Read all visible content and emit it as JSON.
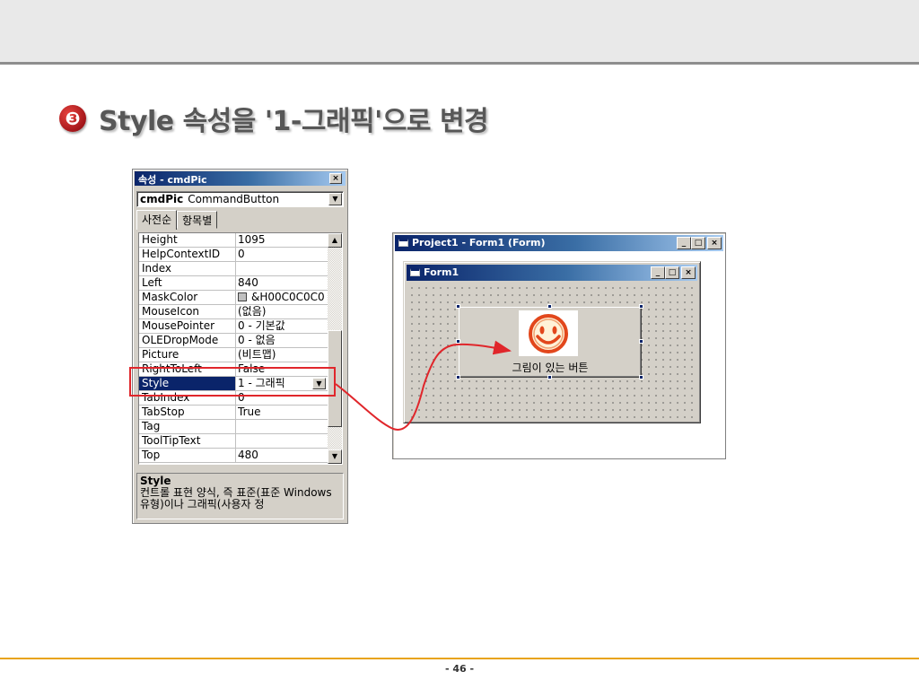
{
  "slide": {
    "step_number": "❸",
    "title": "Style 속성을 '1-그래픽'으로 변경",
    "page_number": "- 46 -"
  },
  "properties_window": {
    "title": "속성 - cmdPic",
    "close_glyph": "×",
    "object_name": "cmdPic",
    "object_type": "CommandButton",
    "tabs": [
      "사전순",
      "항목별"
    ],
    "active_tab": "사전순",
    "rows": [
      {
        "name": "Height",
        "value": "1095"
      },
      {
        "name": "HelpContextID",
        "value": "0"
      },
      {
        "name": "Index",
        "value": ""
      },
      {
        "name": "Left",
        "value": "840"
      },
      {
        "name": "MaskColor",
        "value": "&H00C0C0C0"
      },
      {
        "name": "MouseIcon",
        "value": "(없음)"
      },
      {
        "name": "MousePointer",
        "value": "0 - 기본값"
      },
      {
        "name": "OLEDropMode",
        "value": "0 - 없음"
      },
      {
        "name": "Picture",
        "value": "(비트맵)"
      },
      {
        "name": "RightToLeft",
        "value": "False"
      },
      {
        "name": "Style",
        "value": "1 - 그래픽",
        "selected": true
      },
      {
        "name": "TabIndex",
        "value": "0"
      },
      {
        "name": "TabStop",
        "value": "True"
      },
      {
        "name": "Tag",
        "value": ""
      },
      {
        "name": "ToolTipText",
        "value": ""
      },
      {
        "name": "Top",
        "value": "480"
      }
    ],
    "description": {
      "name": "Style",
      "text": "컨트롤 표현 양식, 즉 표준(표준 Windows 유형)이나 그래픽(사용자 정"
    },
    "highlight_color": "#e0262b"
  },
  "project_window": {
    "title": "Project1 - Form1 (Form)",
    "buttons": [
      "_",
      "□",
      "×"
    ],
    "form": {
      "title": "Form1",
      "buttons": [
        "_",
        "□",
        "×"
      ],
      "command_button": {
        "caption": "그림이 있는 버튼",
        "picture": "smiley-face"
      }
    }
  },
  "colors": {
    "titlebar_start": "#0a246a",
    "titlebar_end": "#a6caf0",
    "accent_red": "#e0262b",
    "footer_line": "#e8a317"
  }
}
